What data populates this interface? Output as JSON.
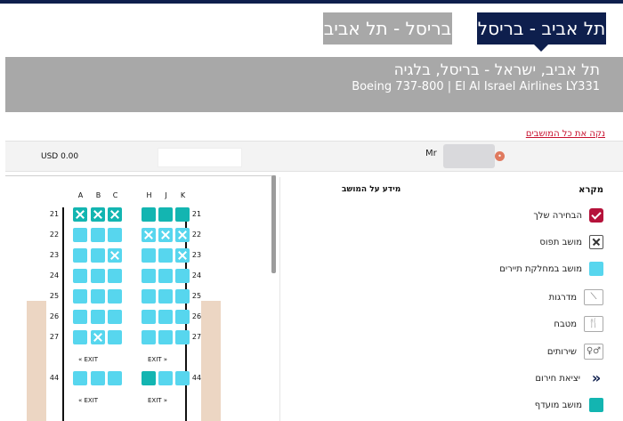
{
  "tabs": [
    {
      "label": "תל אביב - בריסל",
      "active": true
    },
    {
      "label": "בריסל - תל אביב",
      "active": false
    }
  ],
  "route": {
    "title": "תל אביב, ישראל - בריסל, בלגיה",
    "subtitle": "Boeing 737-800 | El Al Israel Airlines LY331"
  },
  "clear_all_label": "נקה את כל המושבים",
  "passenger": {
    "name": "Mr",
    "price": "USD 0.00"
  },
  "seat_map": {
    "columns_left": [
      "A",
      "B",
      "C"
    ],
    "columns_right": [
      "H",
      "J",
      "K"
    ],
    "rows": [
      {
        "row": "21",
        "seats": [
          "occ-pref",
          "occ-pref",
          "occ-pref",
          "pref",
          "pref",
          "pref"
        ]
      },
      {
        "row": "22",
        "seats": [
          "avail",
          "avail",
          "avail",
          "occ",
          "occ",
          "occ"
        ]
      },
      {
        "row": "23",
        "seats": [
          "avail",
          "avail",
          "occ",
          "avail",
          "avail",
          "occ"
        ]
      },
      {
        "row": "24",
        "seats": [
          "avail",
          "avail",
          "avail",
          "avail",
          "avail",
          "avail"
        ]
      },
      {
        "row": "25",
        "seats": [
          "avail",
          "avail",
          "avail",
          "avail",
          "avail",
          "avail"
        ]
      },
      {
        "row": "26",
        "seats": [
          "avail",
          "avail",
          "avail",
          "avail",
          "avail",
          "avail"
        ]
      },
      {
        "row": "27",
        "seats": [
          "avail",
          "occ",
          "avail",
          "avail",
          "avail",
          "avail"
        ]
      },
      {
        "row": "44",
        "seats": [
          "avail",
          "avail",
          "avail",
          "pref",
          "avail",
          "avail"
        ]
      }
    ],
    "exit_label": "EXIT"
  },
  "legend": {
    "title": "מקרא",
    "info_title": "מידע על המושב",
    "items": [
      {
        "icon": "selected-seat-icon",
        "label": "הבחירה שלך"
      },
      {
        "icon": "occupied-seat-icon",
        "label": "מושב תפוס"
      },
      {
        "icon": "economy-seat-icon",
        "label": "מושב במחלקת תיירים"
      },
      {
        "icon": "stairs-icon",
        "label": "מדרגות"
      },
      {
        "icon": "galley-icon",
        "label": "מטבח"
      },
      {
        "icon": "restroom-icon",
        "label": "שירותים"
      },
      {
        "icon": "emergency-exit-icon",
        "label": "יציאת חירום"
      },
      {
        "icon": "preferred-seat-icon",
        "label": "מושב מועדף"
      }
    ]
  },
  "colors": {
    "navy": "#0e1f4d",
    "grey_banner": "#a8a8a8",
    "seat_available": "#57d6ee",
    "seat_preferred": "#13b5b1",
    "selected": "#b5123a",
    "link_red": "#c7102e"
  }
}
